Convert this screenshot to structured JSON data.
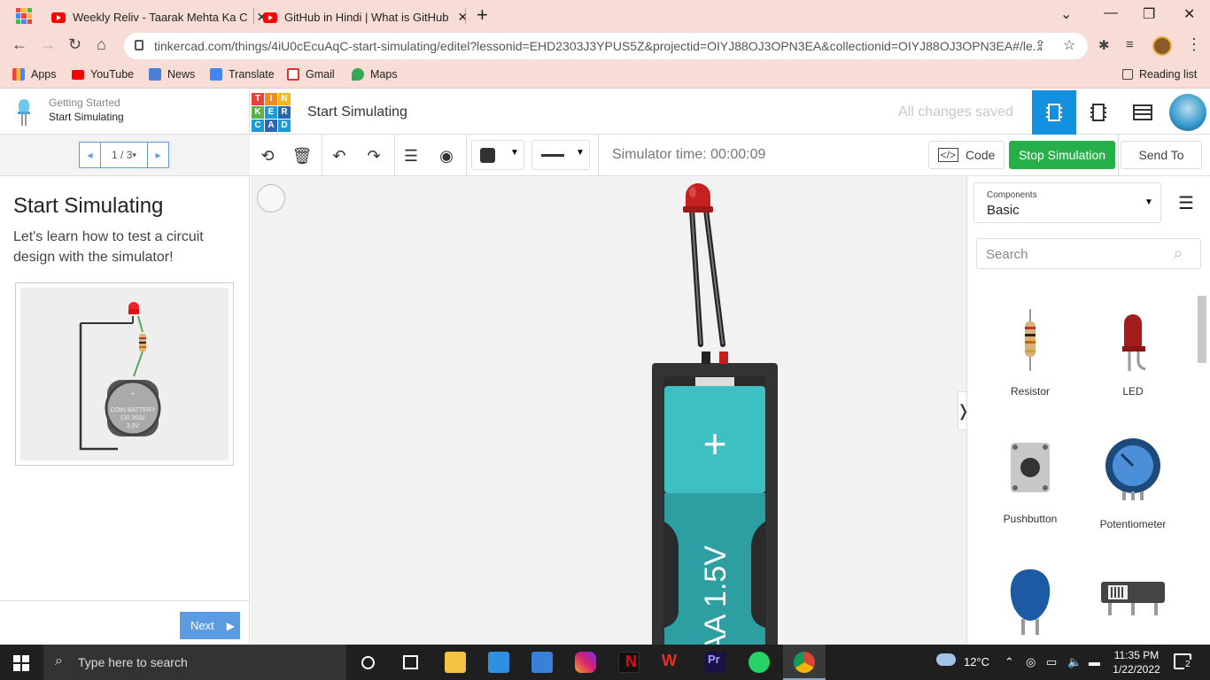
{
  "browser": {
    "tabs": [
      {
        "title": "Weekly Reliv - Taarak Mehta Ka C"
      },
      {
        "title": "GitHub in Hindi | What is GitHub"
      }
    ],
    "url": "tinkercad.com/things/4iU0cEcuAqC-start-simulating/editel?lessonid=EHD2303J3YPUS5Z&projectid=OIYJ88OJ3OPN3EA&collectionid=OIYJ88OJ3OPN3EA#/le...",
    "bookmarks": [
      "Apps",
      "YouTube",
      "News",
      "Translate",
      "Gmail",
      "Maps"
    ],
    "reading_list": "Reading list"
  },
  "lesson_panel": {
    "subtitle": "Getting Started",
    "title": "Start Simulating",
    "pager": "1 / 3",
    "heading": "Start Simulating",
    "text": "Let's learn how to test a circuit design with the simulator!",
    "next_label": "Next",
    "diagram_battery_text": [
      "COIN BATTERY",
      "CR 2032",
      "3.0V"
    ]
  },
  "header": {
    "logo_letters": [
      "T",
      "I",
      "N",
      "K",
      "E",
      "R",
      "C",
      "A",
      "D"
    ],
    "project_title": "Start Simulating",
    "save_status": "All changes saved"
  },
  "toolbar": {
    "sim_time": "Simulator time: 00:00:09",
    "code_label": "Code",
    "stop_label": "Stop Simulation",
    "send_label": "Send To"
  },
  "canvas": {
    "battery_plus": "+",
    "battery_label": "AA 1.5V"
  },
  "components_panel": {
    "select_label": "Components",
    "select_value": "Basic",
    "search_placeholder": "Search",
    "items": [
      "Resistor",
      "LED",
      "Pushbutton",
      "Potentiometer"
    ]
  },
  "taskbar": {
    "search_placeholder": "Type here to search",
    "weather": "12°C",
    "time": "11:35 PM",
    "date": "1/22/2022",
    "notifications": "2"
  },
  "colors": {
    "tinkercad_blue": "#1490e0",
    "stop_green": "#27b04a",
    "lesson_blue": "#5b9be2",
    "battery_teal": "#3ec0c3"
  }
}
